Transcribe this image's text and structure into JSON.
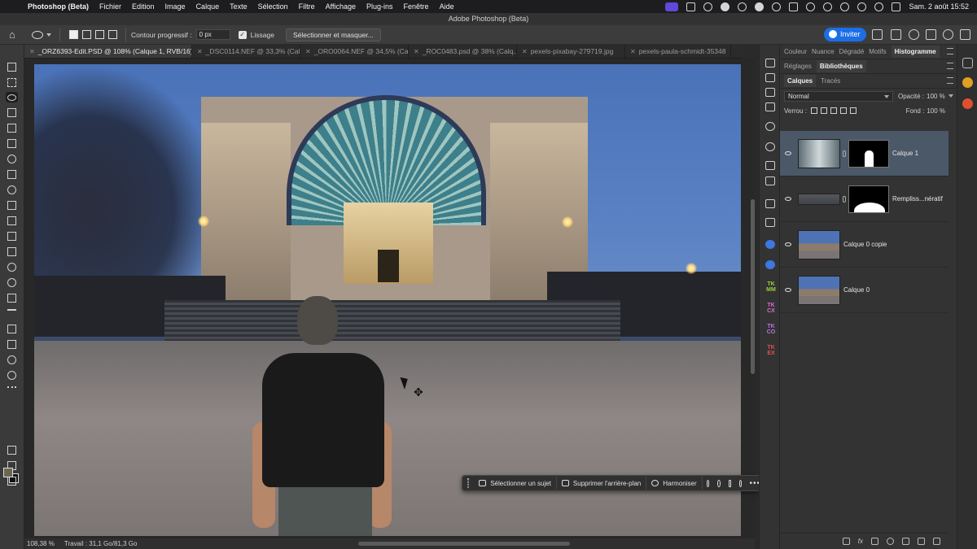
{
  "menubar": {
    "app": "Photoshop (Beta)",
    "items": [
      "Fichier",
      "Edition",
      "Image",
      "Calque",
      "Texte",
      "Sélection",
      "Filtre",
      "Affichage",
      "Plug-ins",
      "Fenêtre",
      "Aide"
    ],
    "clock": "Sam. 2 août  15:52"
  },
  "window": {
    "title": "Adobe Photoshop (Beta)"
  },
  "options": {
    "feather_label": "Contour progressif :",
    "feather_value": "0 px",
    "antialias_label": "Lissage",
    "select_mask_button": "Sélectionner et masquer...",
    "invite_button": "Inviter"
  },
  "tabs": [
    {
      "label": "_ORZ6393-Edit.PSD @ 108% (Calque 1, RVB/16) *",
      "active": true
    },
    {
      "label": "_DSC0114.NEF @ 33,3% (Cal...",
      "active": false
    },
    {
      "label": "_ORO0064.NEF @ 34,5% (Ca...",
      "active": false
    },
    {
      "label": "_ROC0483.psd @ 38% (Calq...",
      "active": false
    },
    {
      "label": "pexels-pixabay-279719.jpg",
      "active": false
    },
    {
      "label": "pexels-paula-schmidt-35348",
      "active": false
    }
  ],
  "contextbar": {
    "select_subject": "Sélectionner un sujet",
    "remove_background": "Supprimer l'arrière-plan",
    "harmonize": "Harmoniser"
  },
  "status": {
    "zoom": "108,38 %",
    "work": "Travail : 31,1 Go/81,3 Go"
  },
  "panels": {
    "row1_tabs": [
      "Couleur",
      "Nuance",
      "Dégradé",
      "Motifs",
      "Histogramme"
    ],
    "row1_active": "Histogramme",
    "row2_tabs": [
      "Réglages",
      "Bibliothèques"
    ],
    "row2_active": "Bibliothèques",
    "row3_tabs": [
      "Calques",
      "Tracés"
    ],
    "row3_active": "Calques",
    "blend_mode": "Normal",
    "opacity_label": "Opacité :",
    "opacity_value": "100 %",
    "lock_label": "Verrou :",
    "fill_label": "Fond :",
    "fill_value": "100 %",
    "layers": [
      {
        "name": "Calque 1",
        "selected": true
      },
      {
        "name": "Rempliss...nératif",
        "selected": false
      },
      {
        "name": "Calque 0 copie",
        "selected": false
      },
      {
        "name": "Calque 0",
        "selected": false
      }
    ],
    "fx_label": "fx"
  },
  "dock": {
    "tk_labels": [
      {
        "top": "TK",
        "bottom": "MM",
        "color": "#9ccf3a"
      },
      {
        "top": "TK",
        "bottom": "CX",
        "color": "#e06ad0"
      },
      {
        "top": "TK",
        "bottom": "CO",
        "color": "#c070e0"
      },
      {
        "top": "TK",
        "bottom": "EX",
        "color": "#e05050"
      }
    ]
  },
  "colors": {
    "accent": "#1b6ee6",
    "selected_layer": "#4a5868",
    "foreground": "#6b6654",
    "background": "#111111"
  }
}
